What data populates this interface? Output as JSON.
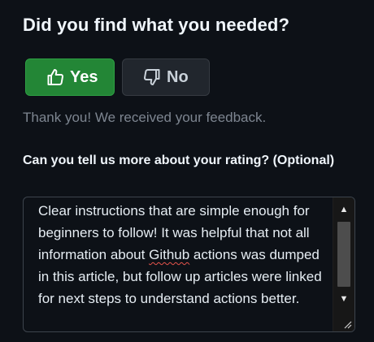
{
  "feedback": {
    "heading": "Did you find what you needed?",
    "yes_label": "Yes",
    "no_label": "No",
    "thanks_message": "Thank you! We received your feedback.",
    "details_label": "Can you tell us more about your rating? (Optional)",
    "details_value_before": "Clear instructions that are simple enough for beginners to follow! It was helpful that not all information about ",
    "details_value_misspelled": "Github",
    "details_value_after": " actions was dumped in this article, but follow up articles were linked for next steps to understand actions better.",
    "scroll_up_glyph": "▲",
    "scroll_down_glyph": "▼"
  },
  "icons": {
    "yes": "thumbs-up-icon",
    "no": "thumbs-down-icon"
  },
  "colors": {
    "background": "#0d1117",
    "yes_button": "#238636",
    "no_button": "#21262d",
    "muted_text": "#7d8590",
    "spellcheck_underline": "#e5534b"
  }
}
